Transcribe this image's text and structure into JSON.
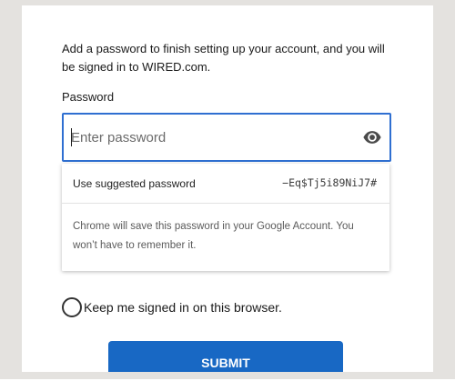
{
  "intro_text": "Add a password to finish setting up your account, and you will be signed in to WIRED.com.",
  "password": {
    "label": "Password",
    "placeholder": "Enter password",
    "value": ""
  },
  "suggestion": {
    "label": "Use suggested password",
    "value": "−Eq$Tj5i89NiJ7#",
    "note": "Chrome will save this password in your Google Account. You won’t have to remember it."
  },
  "keep_signed_in": {
    "label": "Keep me signed in on this browser.",
    "checked": false
  },
  "submit_label": "SUBMIT",
  "colors": {
    "accent": "#2f6fd1",
    "button": "#1868c4",
    "frame": "#e4e2df"
  },
  "icons": {
    "reveal": "eye-icon"
  }
}
